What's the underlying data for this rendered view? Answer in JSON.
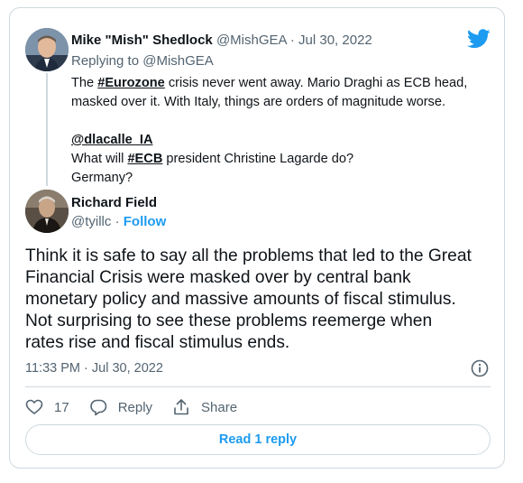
{
  "parent_tweet": {
    "author_name": "Mike \"Mish\" Shedlock",
    "handle": "@MishGEA",
    "separator": " · ",
    "date": "Jul 30, 2022",
    "replying_to_label": "Replying to",
    "replying_to_handle": "@MishGEA",
    "text": {
      "l1_a": "The ",
      "l1_hashtag": "#Eurozone",
      "l1_b": " crisis never went away. Mario Draghi as ECB head,",
      "l2": "masked over it. With Italy, things are orders of magnitude worse.",
      "mention": "@dlacalle_IA",
      "l4_a": "What will ",
      "l4_hashtag": "#ECB",
      "l4_b": " president Christine Lagarde do?",
      "l5": "Germany?"
    }
  },
  "reply_tweet": {
    "author_name": "Richard Field",
    "handle": "@tyillc",
    "separator": " · ",
    "follow_label": "Follow",
    "text_lines": [
      "Think it is safe to say all the problems that led to the Great",
      "Financial Crisis were masked over by central bank",
      "monetary policy and massive amounts of fiscal stimulus.",
      "Not surprising to see these problems reemerge when",
      "rates rise and fiscal stimulus ends."
    ],
    "timestamp": "11:33 PM · Jul 30, 2022",
    "likes_count": "17",
    "reply_label": "Reply",
    "share_label": "Share",
    "read_replies_label": "Read 1 reply"
  },
  "icons": {
    "brand": "twitter-bird-icon",
    "info": "info-icon",
    "like": "heart-icon",
    "reply": "speech-bubble-icon",
    "share": "share-icon"
  },
  "colors": {
    "accent": "#1d9bf0",
    "text_primary": "#0f1419",
    "text_secondary": "#536471",
    "border": "#cfd9de"
  }
}
